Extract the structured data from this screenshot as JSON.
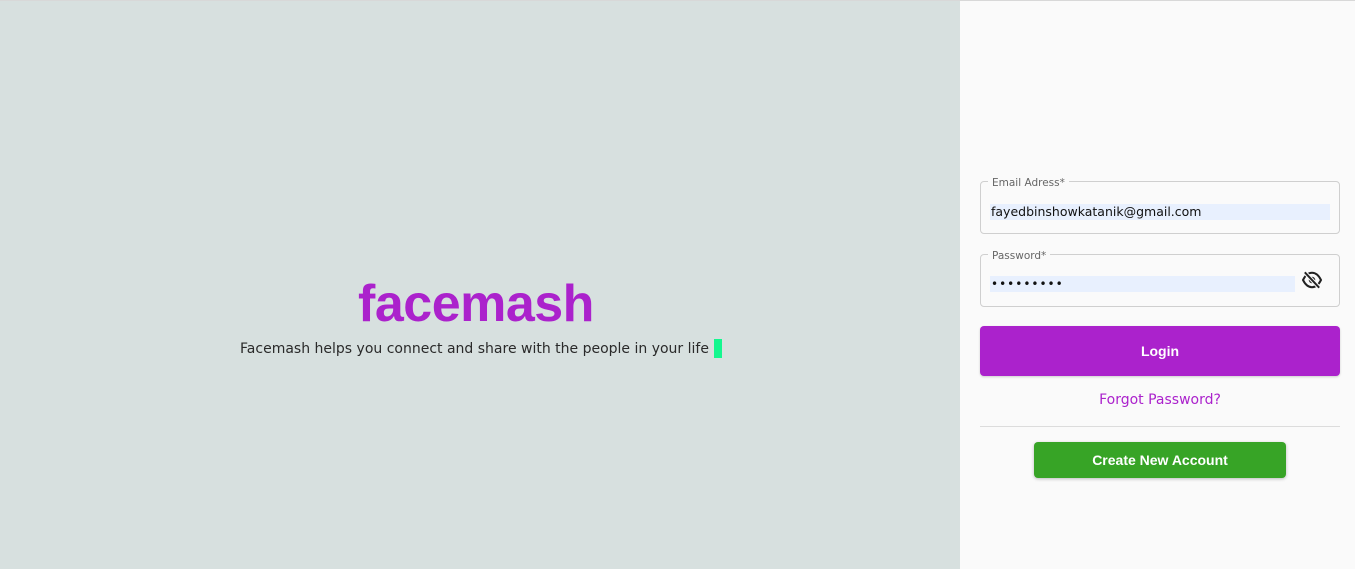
{
  "brand": {
    "name": "facemash",
    "tagline": "Facemash helps you connect and share with the people in your life"
  },
  "login_form": {
    "email": {
      "label": "Email Adress*",
      "value": "fayedbinshowkatanik@gmail.com"
    },
    "password": {
      "label": "Password*",
      "value": "•••••••••",
      "toggle_icon": "eye-off-icon"
    },
    "login_label": "Login",
    "forgot_label": "Forgot Password?",
    "create_label": "Create New Account"
  },
  "colors": {
    "brand_purple": "#ab22cc",
    "create_green": "#37a426",
    "left_background": "#d7e0df",
    "cursor_green": "#14f78f"
  }
}
